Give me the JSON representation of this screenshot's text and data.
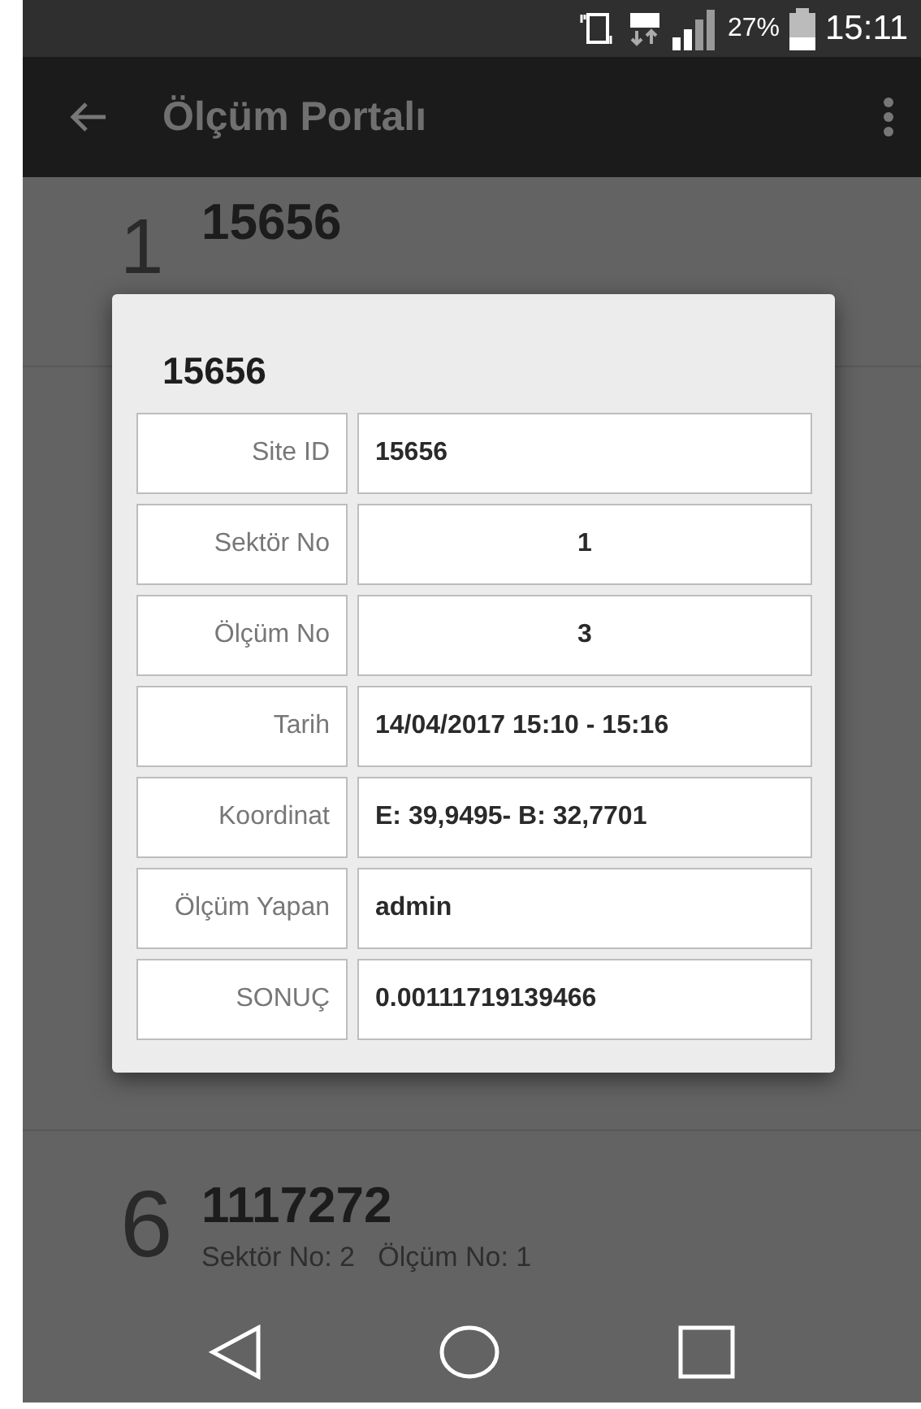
{
  "status_bar": {
    "battery": "27%",
    "time": "15:11"
  },
  "toolbar": {
    "title": "Ölçüm Portalı"
  },
  "list": [
    {
      "number": "1",
      "title": "15656"
    },
    {
      "number": "6",
      "title": "1117272",
      "subtitle": "Sektör No: 2   Ölçüm No: 1"
    }
  ],
  "dialog": {
    "title": "15656",
    "rows": [
      {
        "label": "Site ID",
        "value": "15656",
        "kind": "text"
      },
      {
        "label": "Sektör No",
        "value": "1",
        "kind": "number"
      },
      {
        "label": "Ölçüm No",
        "value": "3",
        "kind": "number"
      },
      {
        "label": "Tarih",
        "value": "14/04/2017 15:10 - 15:16",
        "kind": "text"
      },
      {
        "label": "Koordinat",
        "value": "E: 39,9495- B: 32,7701",
        "kind": "text"
      },
      {
        "label": "Ölçüm Yapan",
        "value": "admin",
        "kind": "text"
      },
      {
        "label": "SONUÇ",
        "value": "0.00111719139466",
        "kind": "text"
      }
    ]
  }
}
